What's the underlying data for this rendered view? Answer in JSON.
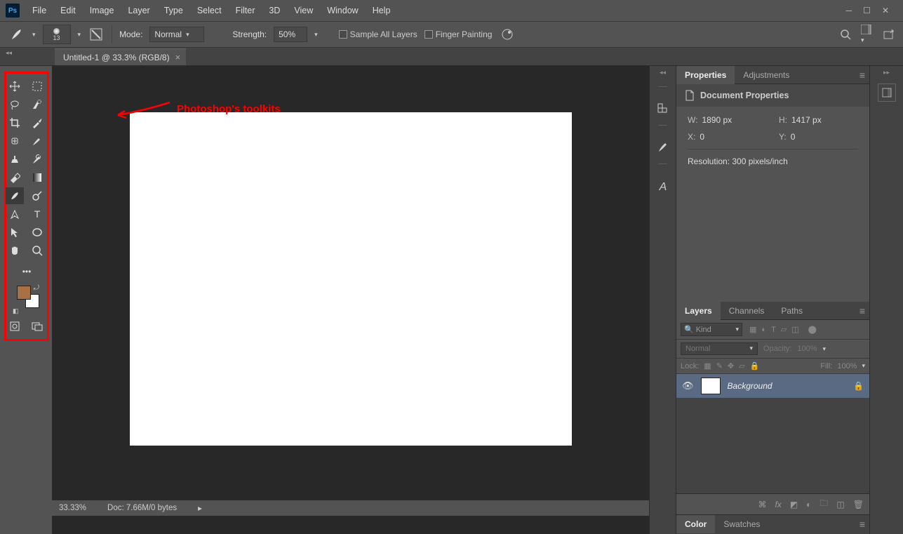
{
  "menubar": {
    "items": [
      "File",
      "Edit",
      "Image",
      "Layer",
      "Type",
      "Select",
      "Filter",
      "3D",
      "View",
      "Window",
      "Help"
    ]
  },
  "optionsbar": {
    "brush_size": "13",
    "mode_label": "Mode:",
    "mode_value": "Normal",
    "strength_label": "Strength:",
    "strength_value": "50%",
    "sample_all_layers": "Sample All Layers",
    "finger_painting": "Finger Painting"
  },
  "tabs": {
    "doc1": "Untitled-1 @ 33.3% (RGB/8)"
  },
  "annotation": "Photoshop's toolkits",
  "tools": [
    [
      "move",
      "marquee"
    ],
    [
      "lasso",
      "quick-select"
    ],
    [
      "crop",
      "eyedropper"
    ],
    [
      "spot-heal",
      "brush"
    ],
    [
      "clone",
      "history-brush"
    ],
    [
      "eraser",
      "gradient"
    ],
    [
      "smudge",
      "dodge"
    ],
    [
      "pen",
      "type"
    ],
    [
      "path-select",
      "shape"
    ],
    [
      "hand",
      "zoom"
    ]
  ],
  "properties_panel": {
    "tab_properties": "Properties",
    "tab_adjustments": "Adjustments",
    "header": "Document Properties",
    "w_label": "W:",
    "w_value": "1890 px",
    "h_label": "H:",
    "h_value": "1417 px",
    "x_label": "X:",
    "x_value": "0",
    "y_label": "Y:",
    "y_value": "0",
    "resolution": "Resolution: 300 pixels/inch"
  },
  "layers_panel": {
    "tab_layers": "Layers",
    "tab_channels": "Channels",
    "tab_paths": "Paths",
    "filter_kind": "Kind",
    "blend_mode": "Normal",
    "opacity_label": "Opacity:",
    "opacity_value": "100%",
    "lock_label": "Lock:",
    "fill_label": "Fill:",
    "fill_value": "100%",
    "layer_name": "Background"
  },
  "color_panel": {
    "tab_color": "Color",
    "tab_swatches": "Swatches"
  },
  "statusbar": {
    "zoom": "33.33%",
    "doc_info": "Doc: 7.66M/0 bytes"
  },
  "swatches": {
    "fg": "#a87045",
    "bg": "#ffffff"
  }
}
